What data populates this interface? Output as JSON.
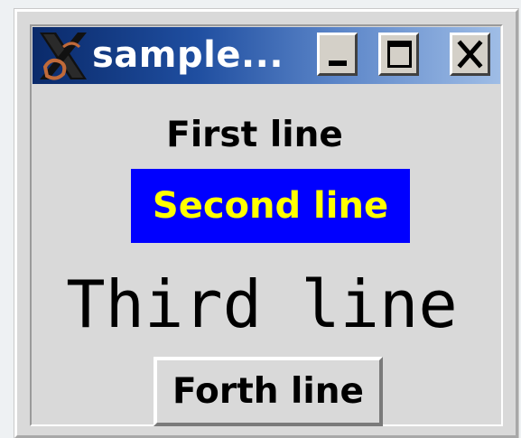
{
  "window": {
    "title": "sample...",
    "controls": {
      "minimize_icon": "minimize-icon",
      "maximize_icon": "maximize-icon",
      "close_icon": "close-icon"
    },
    "app_icon": "x-window-system-icon"
  },
  "content": {
    "first_line": "First line",
    "second_line": "Second line",
    "third_line": "Third line",
    "forth_line": "Forth line"
  },
  "colors": {
    "titlebar_dark": "#0a2a6a",
    "titlebar_light": "#9fbde6",
    "window_bg": "#d9d9d9",
    "second_line_bg": "#0000ff",
    "second_line_fg": "#ffff00"
  }
}
